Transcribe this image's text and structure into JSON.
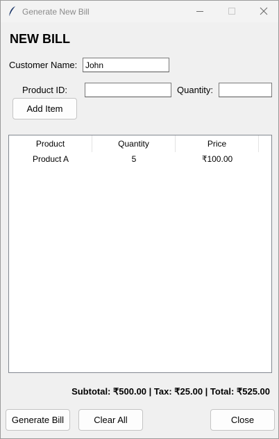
{
  "window": {
    "title": "Generate New Bill",
    "accent": "#0078d4"
  },
  "form": {
    "heading": "NEW BILL",
    "customer_label": "Customer Name:",
    "customer_value": "John",
    "product_id_label": "Product ID:",
    "product_id_value": "",
    "quantity_label": "Quantity:",
    "quantity_value": "",
    "add_item_label": "Add Item"
  },
  "table": {
    "columns": [
      "Product",
      "Quantity",
      "Price"
    ],
    "rows": [
      {
        "product": "Product A",
        "quantity": "5",
        "price": "₹100.00"
      }
    ]
  },
  "summary": {
    "text": "Subtotal: ₹500.00 | Tax: ₹25.00 | Total: ₹525.00"
  },
  "actions": {
    "generate_label": "Generate Bill",
    "clear_label": "Clear All",
    "close_label": "Close"
  },
  "icons": {
    "app": "feather-icon",
    "minimize": "minimize-icon",
    "maximize": "maximize-icon",
    "close": "close-icon"
  }
}
